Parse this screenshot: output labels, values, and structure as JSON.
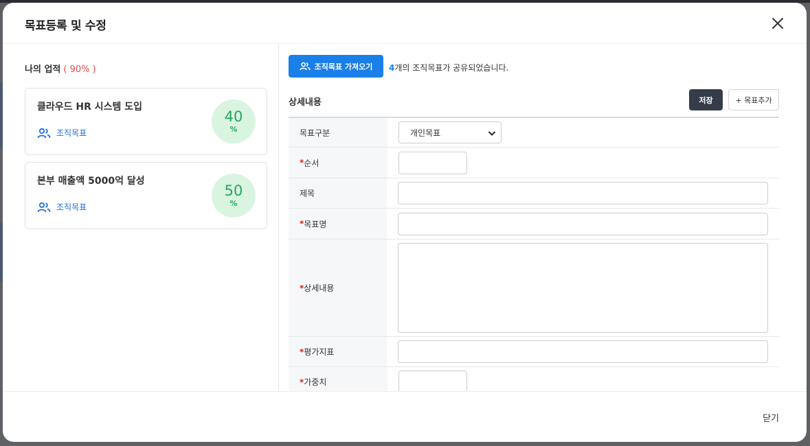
{
  "modal": {
    "title": "목표등록 및 수정",
    "close_icon": "close-icon"
  },
  "left": {
    "title": "나의 업적",
    "percent": "( 90% )",
    "goals": [
      {
        "title": "클라우드 HR 시스템 도입",
        "type": "조직목표",
        "progress": "40",
        "unit": "%",
        "icon": "users-icon"
      },
      {
        "title": "본부 매출액 5000억 달성",
        "type": "조직목표",
        "progress": "50",
        "unit": "%",
        "icon": "users-icon"
      }
    ]
  },
  "right": {
    "fetch_button": "조직목표 가져오기",
    "shared_count": "4",
    "shared_text": "개의 조직목표가 공유되었습니다.",
    "section_label": "상세내용",
    "save_button": "저장",
    "add_button": "+ 목표추가",
    "rows": [
      {
        "label": "목표구분",
        "required": false,
        "select_value": "개인목표"
      },
      {
        "label": "순서",
        "required": true,
        "value": ""
      },
      {
        "label": "제목",
        "required": false,
        "value": ""
      },
      {
        "label": "목표명",
        "required": true,
        "value": ""
      },
      {
        "label": "상세내용",
        "required": true,
        "value": ""
      },
      {
        "label": "평가지표",
        "required": true,
        "value": ""
      },
      {
        "label": "가중치",
        "required": true,
        "value": ""
      }
    ]
  },
  "footer": {
    "close_label": "닫기"
  },
  "colors": {
    "primary": "#1a7fe8",
    "dark_button": "#353c4a",
    "progress_bg": "#d9f5e2",
    "progress_text": "#26a65b",
    "required": "#d81f26",
    "percent": "#e5484d"
  }
}
